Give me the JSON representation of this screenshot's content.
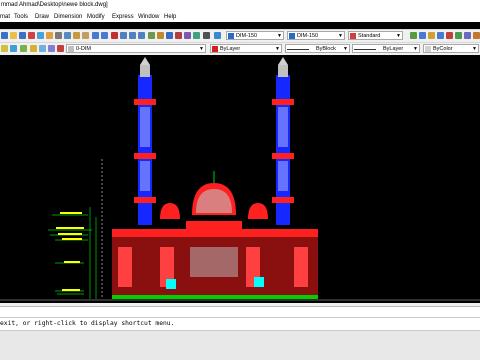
{
  "window": {
    "title": "mmad Ahmad\\Desktop\\newe block.dwg]"
  },
  "menu": [
    "mat",
    "Tools",
    "Draw",
    "Dimension",
    "Modify",
    "Express",
    "Window",
    "Help"
  ],
  "toolbar": {
    "layer_combo": "0-DIM",
    "dimstyle_1": "DIM-150",
    "dimstyle_2": "DIM-150",
    "textstyle": "Standard",
    "layer_color": "ByLayer",
    "linetype": "ByBlock",
    "lineweight": "ByLayer",
    "plotstyle": "ByColor"
  },
  "command_line": {
    "prompt": "exit, or right-click to display shortcut menu."
  },
  "colors": {
    "canvas": "#000000",
    "blue": "#1428ff",
    "red": "#ff2020",
    "green": "#00d000",
    "cyan": "#00ffff",
    "yellow": "#ffff00"
  }
}
